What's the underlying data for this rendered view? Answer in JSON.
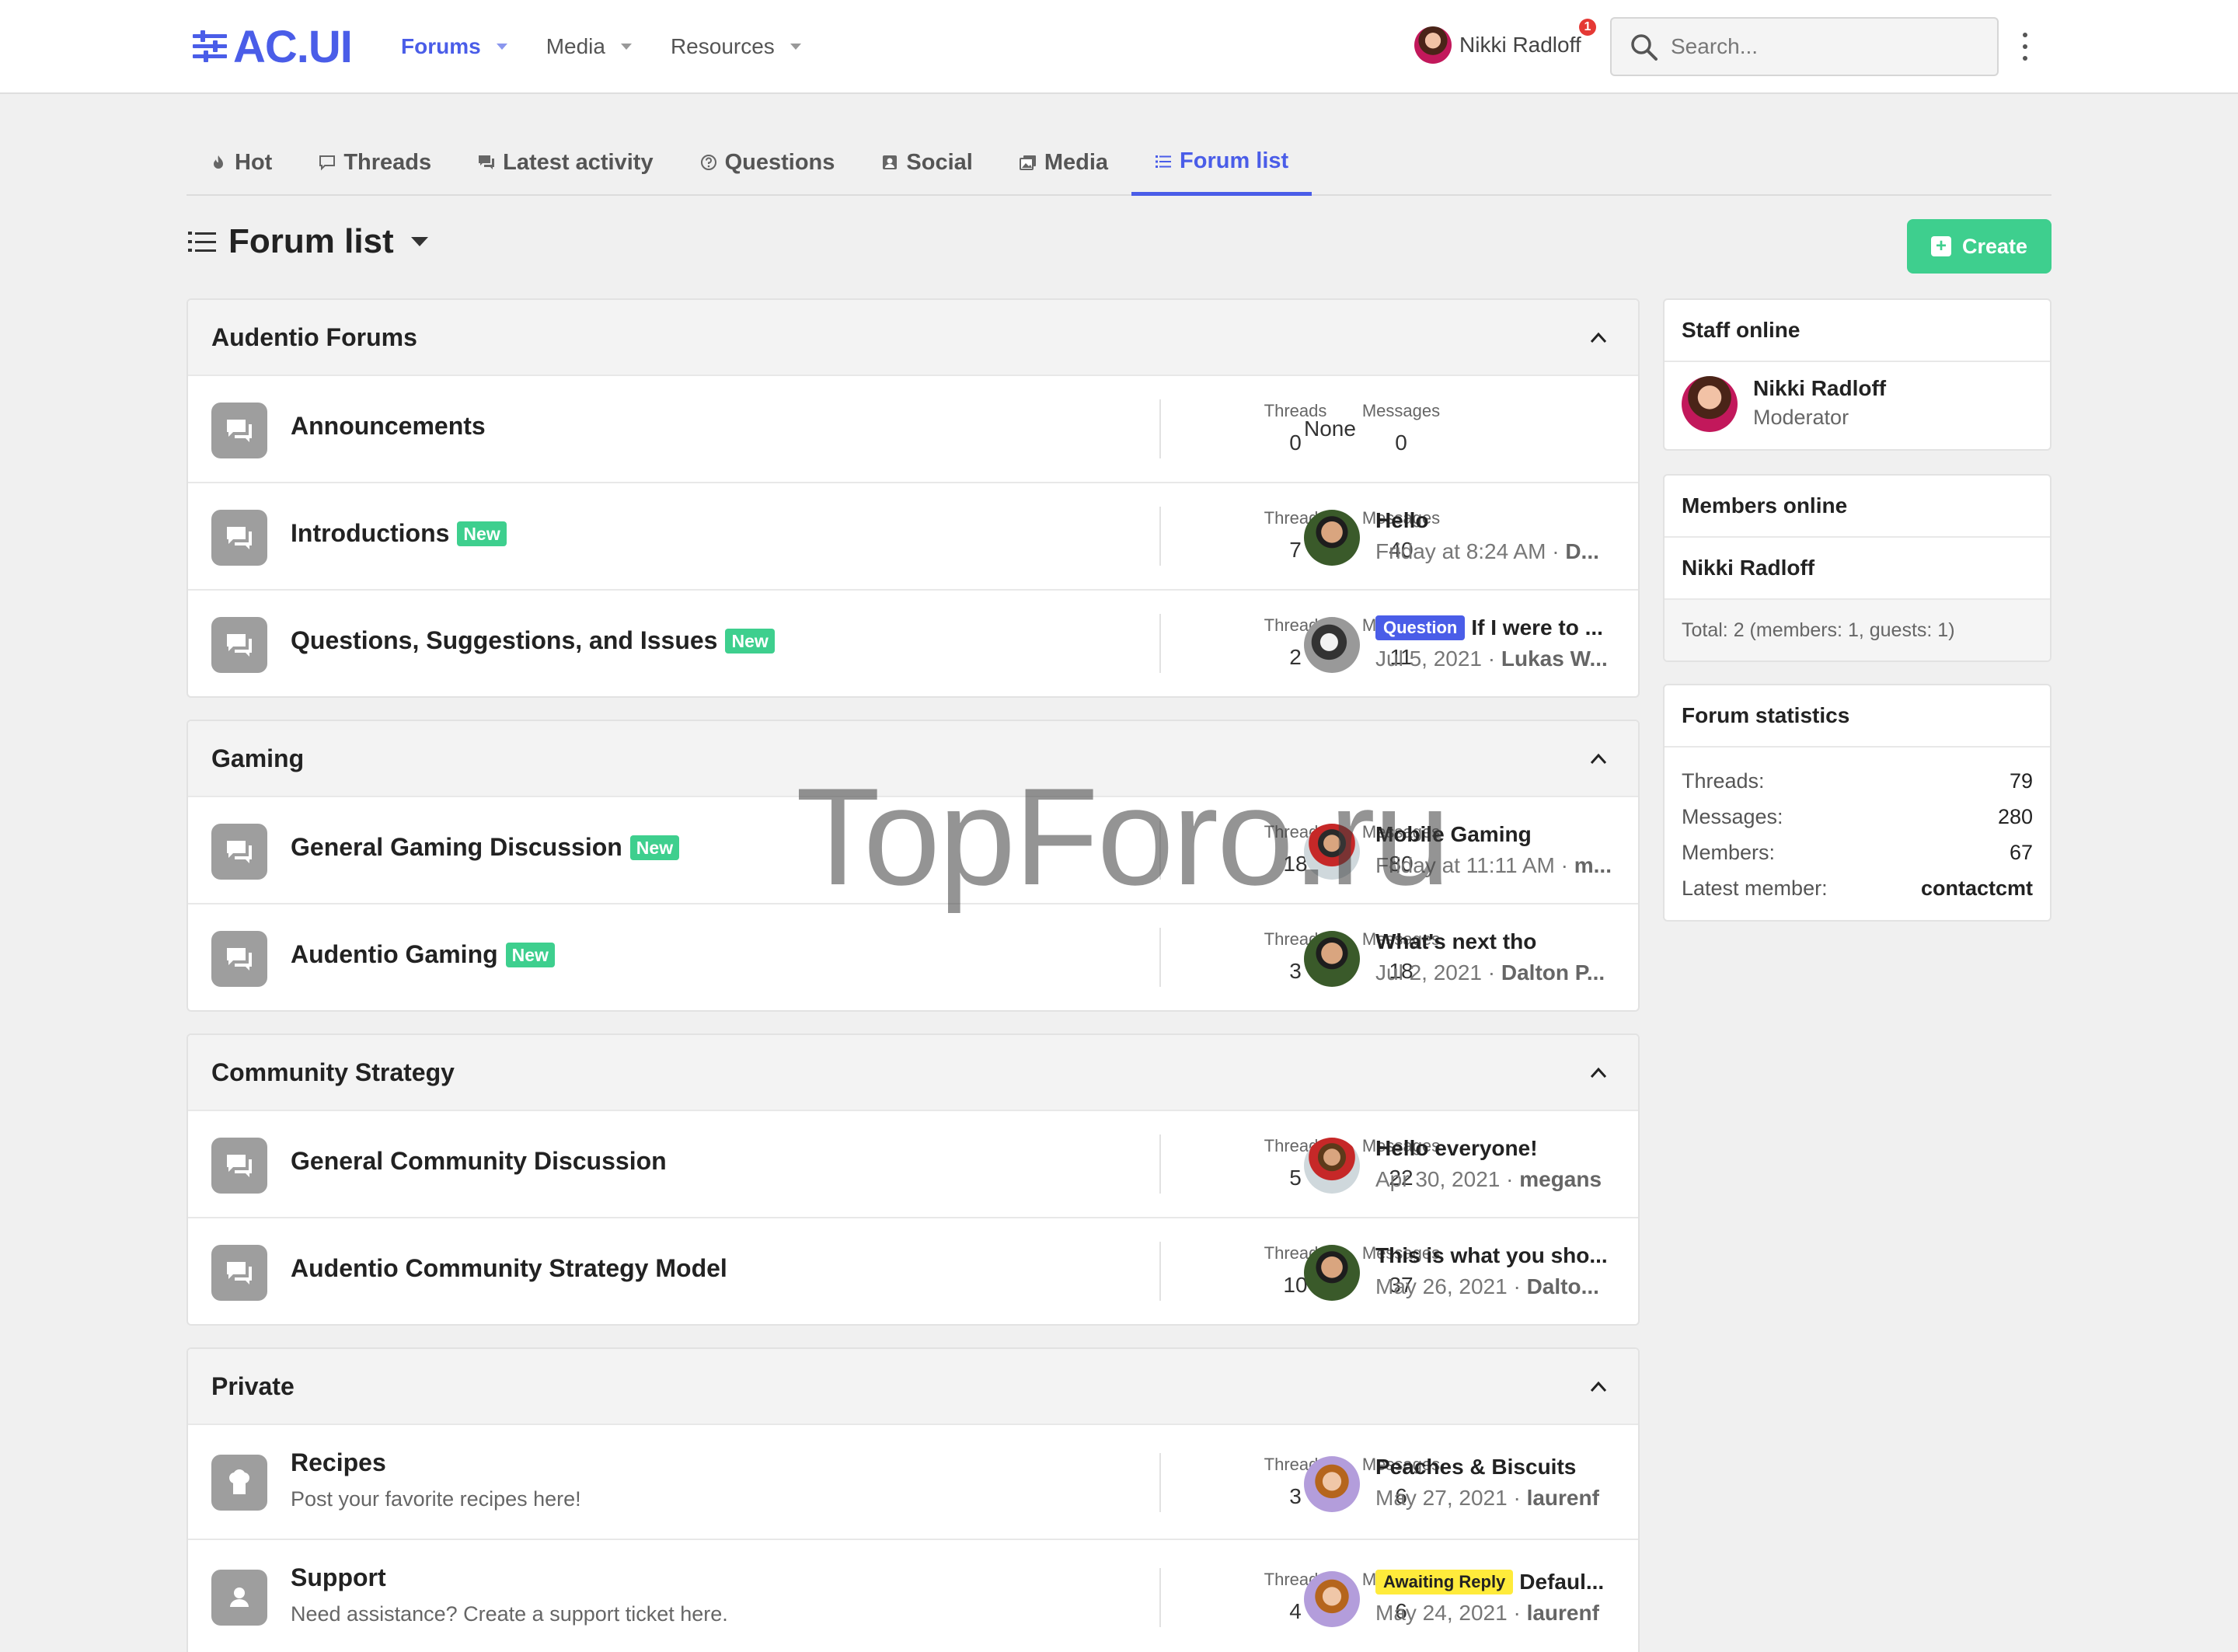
{
  "header": {
    "logo_text": "AC.UI",
    "nav": [
      {
        "label": "Forums",
        "active": true
      },
      {
        "label": "Media",
        "active": false
      },
      {
        "label": "Resources",
        "active": false
      }
    ],
    "user_name": "Nikki Radloff",
    "notification_count": "1",
    "search_placeholder": "Search..."
  },
  "tabs": [
    {
      "label": "Hot",
      "icon": "flame-icon"
    },
    {
      "label": "Threads",
      "icon": "comment-icon"
    },
    {
      "label": "Latest activity",
      "icon": "comments-icon"
    },
    {
      "label": "Questions",
      "icon": "question-circle-icon"
    },
    {
      "label": "Social",
      "icon": "user-square-icon"
    },
    {
      "label": "Media",
      "icon": "images-icon"
    },
    {
      "label": "Forum list",
      "icon": "list-icon",
      "active": true
    }
  ],
  "page": {
    "title": "Forum list",
    "create_label": "Create"
  },
  "stat_labels": {
    "threads": "Threads",
    "messages": "Messages"
  },
  "categories": [
    {
      "title": "Audentio Forums",
      "nodes": [
        {
          "title": "Announcements",
          "new": false,
          "threads": "0",
          "messages": "0",
          "last_none": "None"
        },
        {
          "title": "Introductions",
          "new": true,
          "threads": "7",
          "messages": "40",
          "last_title": "Hello",
          "last_date": "Friday at 8:24 AM",
          "last_user": "D..."
        },
        {
          "title": "Questions, Suggestions, and Issues",
          "new": true,
          "threads": "2",
          "messages": "11",
          "last_prefix": "Question",
          "last_title": "If I were to ...",
          "last_date": "Jul 5, 2021",
          "last_user": "Lukas W..."
        }
      ]
    },
    {
      "title": "Gaming",
      "nodes": [
        {
          "title": "General Gaming Discussion",
          "new": true,
          "threads": "18",
          "messages": "80",
          "last_title": "Mobile Gaming",
          "last_date": "Friday at 11:11 AM",
          "last_user": "m..."
        },
        {
          "title": "Audentio Gaming",
          "new": true,
          "threads": "3",
          "messages": "18",
          "last_title": "What's next tho",
          "last_date": "Jul 2, 2021",
          "last_user": "Dalton P..."
        }
      ]
    },
    {
      "title": "Community Strategy",
      "nodes": [
        {
          "title": "General Community Discussion",
          "new": false,
          "threads": "5",
          "messages": "22",
          "last_title": "Hello everyone!",
          "last_date": "Apr 30, 2021",
          "last_user": "megans"
        },
        {
          "title": "Audentio Community Strategy Model",
          "new": false,
          "threads": "10",
          "messages": "37",
          "last_title": "This is what you sho...",
          "last_date": "May 26, 2021",
          "last_user": "Dalto..."
        }
      ]
    },
    {
      "title": "Private",
      "nodes": [
        {
          "title": "Recipes",
          "description": "Post your favorite recipes here!",
          "threads": "3",
          "messages": "6",
          "last_title": "Peaches & Biscuits",
          "last_date": "May 27, 2021",
          "last_user": "laurenf"
        },
        {
          "title": "Support",
          "description": "Need assistance? Create a support ticket here.",
          "threads": "4",
          "messages": "6",
          "last_prefix": "Awaiting Reply",
          "last_title": "Defaul...",
          "last_date": "May 24, 2021",
          "last_user": "laurenf"
        }
      ]
    }
  ],
  "new_label": "New",
  "sidebar": {
    "staff": {
      "title": "Staff online",
      "name": "Nikki Radloff",
      "role": "Moderator"
    },
    "members": {
      "title": "Members online",
      "name": "Nikki Radloff",
      "total": "Total: 2 (members: 1, guests: 1)"
    },
    "stats": {
      "title": "Forum statistics",
      "rows": [
        {
          "label": "Threads:",
          "value": "79"
        },
        {
          "label": "Messages:",
          "value": "280"
        },
        {
          "label": "Members:",
          "value": "67"
        },
        {
          "label": "Latest member:",
          "value": "contactcmt"
        }
      ]
    }
  },
  "watermark": "TopForo.ru",
  "colors": {
    "accent": "#4a5de8",
    "new_badge": "#3ecf8e",
    "question_prefix": "#4a5de8",
    "awaiting_prefix": "#ffeb3b"
  }
}
